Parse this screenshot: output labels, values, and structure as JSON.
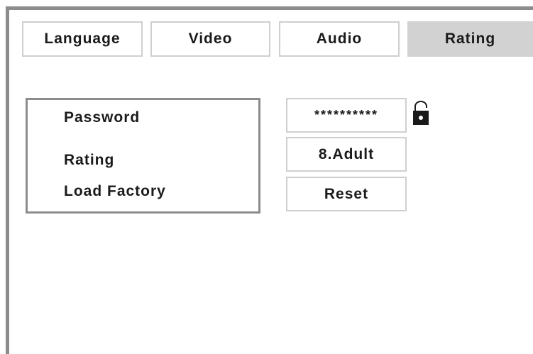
{
  "tabs": [
    {
      "label": "Language",
      "active": false
    },
    {
      "label": "Video",
      "active": false
    },
    {
      "label": "Audio",
      "active": false
    },
    {
      "label": "Rating",
      "active": true
    }
  ],
  "menu": {
    "items": [
      {
        "label": "Password"
      },
      {
        "label": "Rating"
      },
      {
        "label": "Load Factory"
      }
    ]
  },
  "values": {
    "password": "**********",
    "rating": "8.Adult",
    "reset": "Reset"
  },
  "icons": {
    "lock": "unlocked-padlock-icon"
  },
  "colors": {
    "frame": "#8c8c8c",
    "tab_border": "#cfcfcf",
    "active_tab": "#d2d2d2",
    "text": "#1a1a1a"
  }
}
